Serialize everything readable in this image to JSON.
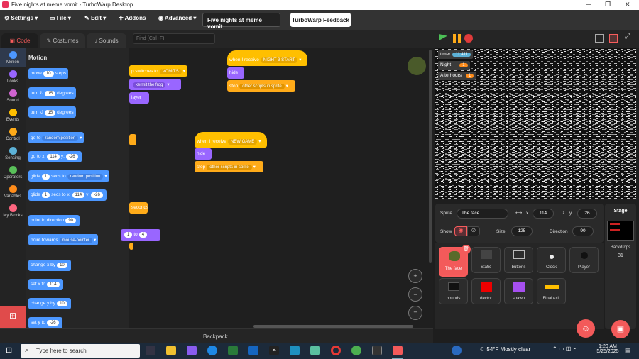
{
  "window": {
    "title": "Five nights at meme vomit - TurboWarp Desktop"
  },
  "menubar": {
    "settings": "Settings",
    "file": "File",
    "edit": "Edit",
    "addons": "Addons",
    "advanced": "Advanced",
    "project_title": "Five nights at meme vomit",
    "feedback": "TurboWarp Feedback"
  },
  "tabs": {
    "code": "Code",
    "costumes": "Costumes",
    "sounds": "Sounds"
  },
  "find": {
    "placeholder": "Find (Ctrl+F)"
  },
  "categories": [
    {
      "label": "Motion",
      "color": "#4c97ff"
    },
    {
      "label": "Looks",
      "color": "#9966ff"
    },
    {
      "label": "Sound",
      "color": "#cf63cf"
    },
    {
      "label": "Events",
      "color": "#ffbf00"
    },
    {
      "label": "Control",
      "color": "#ffab19"
    },
    {
      "label": "Sensing",
      "color": "#5cb1d6"
    },
    {
      "label": "Operators",
      "color": "#59c059"
    },
    {
      "label": "Variables",
      "color": "#ff8c1a"
    },
    {
      "label": "My Blocks",
      "color": "#ff6680"
    }
  ],
  "palette": {
    "heading": "Motion",
    "blocks": {
      "move": {
        "pre": "move",
        "v": "10",
        "post": "steps"
      },
      "turn_r": {
        "pre": "turn",
        "v": "15",
        "post": "degrees"
      },
      "turn_l": {
        "pre": "turn",
        "v": "15",
        "post": "degrees"
      },
      "goto": {
        "pre": "go to",
        "dd": "random position"
      },
      "gotoxy": {
        "pre": "go to x:",
        "x": "114",
        "mid": "y:",
        "y": "-26"
      },
      "glide": {
        "pre": "glide",
        "v": "1",
        "mid": "secs to",
        "dd": "random position"
      },
      "glidexy": {
        "pre": "glide",
        "v": "1",
        "mid": "secs to x:",
        "x": "114",
        "mid2": "y:",
        "y": "-26"
      },
      "point": {
        "pre": "point in direction",
        "v": "90"
      },
      "towards": {
        "pre": "point towards",
        "dd": "mouse-pointer"
      },
      "changex": {
        "pre": "change x by",
        "v": "10"
      },
      "setx": {
        "pre": "set x to",
        "v": "114"
      },
      "changey": {
        "pre": "change y by",
        "v": "10"
      },
      "sety": {
        "pre": "set y to",
        "v": "-26"
      }
    }
  },
  "scripts": {
    "s1": {
      "hat": "when I receive",
      "msg": "NIGHT 3 START",
      "hide": "hide",
      "stop": "stop",
      "stopdd": "other scripts in sprite"
    },
    "s2": {
      "hat": "when I receive",
      "msg": "NEW GAME",
      "hide": "hide",
      "stop": "stop",
      "stopdd": "other scripts in sprite"
    },
    "partial": {
      "a_text": "p switches to",
      "a_dd": "VOMITS",
      "b_text": "witch costume to",
      "b_dd": "kermit the frog",
      "c_text": "layer",
      "d_text": "seconds",
      "e_v1": "1",
      "e_to": "to",
      "e_v2": "4"
    }
  },
  "backpack": "Backpack",
  "monitors": [
    {
      "label": "timer",
      "value": "11.411",
      "color": "#5cb1d6"
    },
    {
      "label": "Night",
      "value": "1",
      "color": "#ff8c1a"
    },
    {
      "label": "Afterhours",
      "value": "1",
      "color": "#ff8c1a"
    }
  ],
  "sprite_info": {
    "sprite_label": "Sprite",
    "sprite_name": "The face",
    "x_label": "x",
    "x": "114",
    "y_label": "y",
    "y": "26",
    "show_label": "Show",
    "size_label": "Size",
    "size": "125",
    "direction_label": "Direction",
    "direction": "90"
  },
  "sprites": [
    "The face",
    "Static",
    "buttons",
    "Clock",
    "Player",
    "bounds",
    "dector",
    "spawn",
    "Final exit"
  ],
  "stage_pane": {
    "title": "Stage",
    "backdrops_label": "Backdrops",
    "backdrops_count": "31"
  },
  "taskbar": {
    "search_placeholder": "Type here to search",
    "weather": "54°F  Mostly clear",
    "time": "1:20 AM",
    "date": "5/25/2025"
  }
}
